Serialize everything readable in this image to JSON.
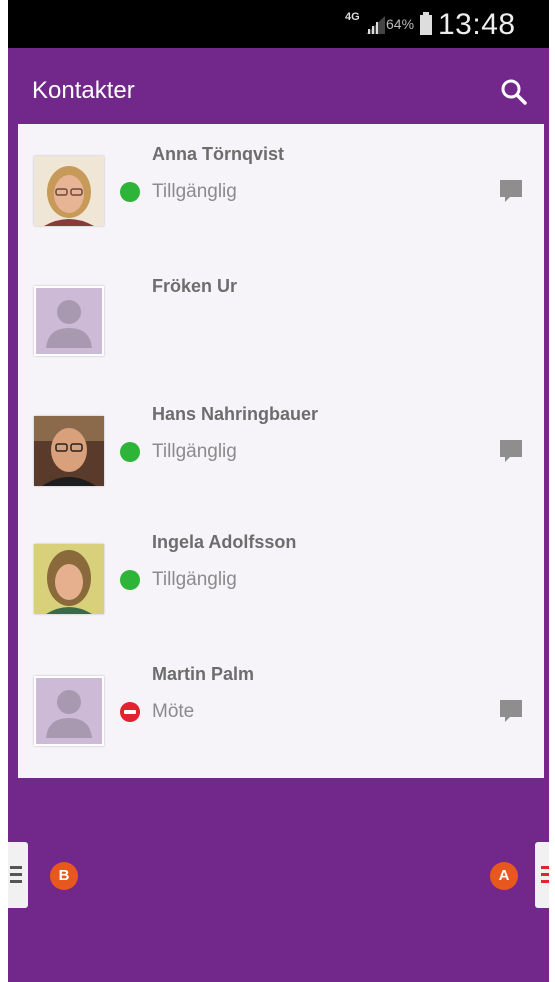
{
  "status_bar": {
    "network": "4G",
    "battery": "64%",
    "time": "13:48"
  },
  "app_bar": {
    "title": "Kontakter",
    "search_icon": "search-icon"
  },
  "contacts": [
    {
      "name": "Anna Törnqvist",
      "status": "Tillgänglig",
      "status_color": "#2fb43a",
      "avatar": "photo",
      "chat": true
    },
    {
      "name": "Fröken Ur",
      "status": "",
      "avatar": "placeholder",
      "chat": false
    },
    {
      "name": "Hans Nahringbauer",
      "status": "Tillgänglig",
      "status_color": "#2fb43a",
      "avatar": "photo",
      "chat": true
    },
    {
      "name": "Ingela Adolfsson",
      "status": "Tillgänglig",
      "status_color": "#2fb43a",
      "avatar": "photo",
      "chat": false
    },
    {
      "name": "Martin Palm",
      "status": "Möte",
      "status_color": "#e0232e",
      "avatar": "placeholder",
      "chat": true
    }
  ],
  "handles": {
    "left_badge": "B",
    "right_badge": "A"
  },
  "colors": {
    "background": "#72278a",
    "list_bg": "#f6f4f8",
    "available": "#2fb43a",
    "busy": "#e0232e",
    "badge": "#e8571d"
  }
}
